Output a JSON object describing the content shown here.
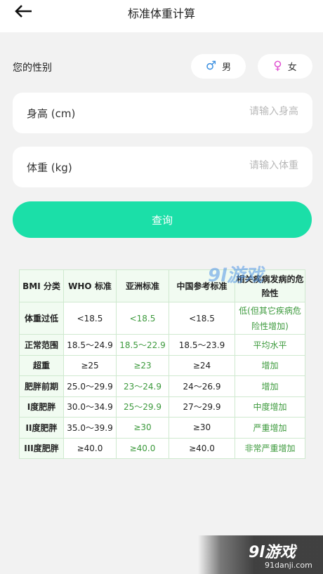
{
  "header": {
    "title": "标准体重计算"
  },
  "gender": {
    "label": "您的性别",
    "male": "男",
    "female": "女",
    "male_color": "#3a8fe0",
    "female_color": "#e04fd0"
  },
  "height": {
    "label": "身高 (cm)",
    "placeholder": "请输入身高"
  },
  "weight": {
    "label": "体重 (kg)",
    "placeholder": "请输入体重"
  },
  "query_button": "查询",
  "accent_color": "#1bdfa8",
  "table": {
    "headers": [
      "BMI 分类",
      "WHO 标准",
      "亚洲标准",
      "中国参考标准",
      "相关疾病发病的危险性"
    ],
    "rows": [
      [
        "体重过低",
        "<18.5",
        "<18.5",
        "<18.5",
        "低(但其它疾病危险性增加)"
      ],
      [
        "正常范围",
        "18.5～24.9",
        "18.5～22.9",
        "18.5～23.9",
        "平均水平"
      ],
      [
        "超重",
        "≥25",
        "≥23",
        "≥24",
        "增加"
      ],
      [
        "肥胖前期",
        "25.0～29.9",
        "23～24.9",
        "24～26.9",
        "增加"
      ],
      [
        "I度肥胖",
        "30.0～34.9",
        "25～29.9",
        "27～29.9",
        "中度增加"
      ],
      [
        "II度肥胖",
        "35.0～39.9",
        "≥30",
        "≥30",
        "严重增加"
      ],
      [
        "III度肥胖",
        "≥40.0",
        "≥40.0",
        "≥40.0",
        "非常严重增加"
      ]
    ]
  },
  "watermark": {
    "mark": "9l游戏",
    "corner_logo": "9l游戏",
    "corner_url": "91danji.com"
  }
}
